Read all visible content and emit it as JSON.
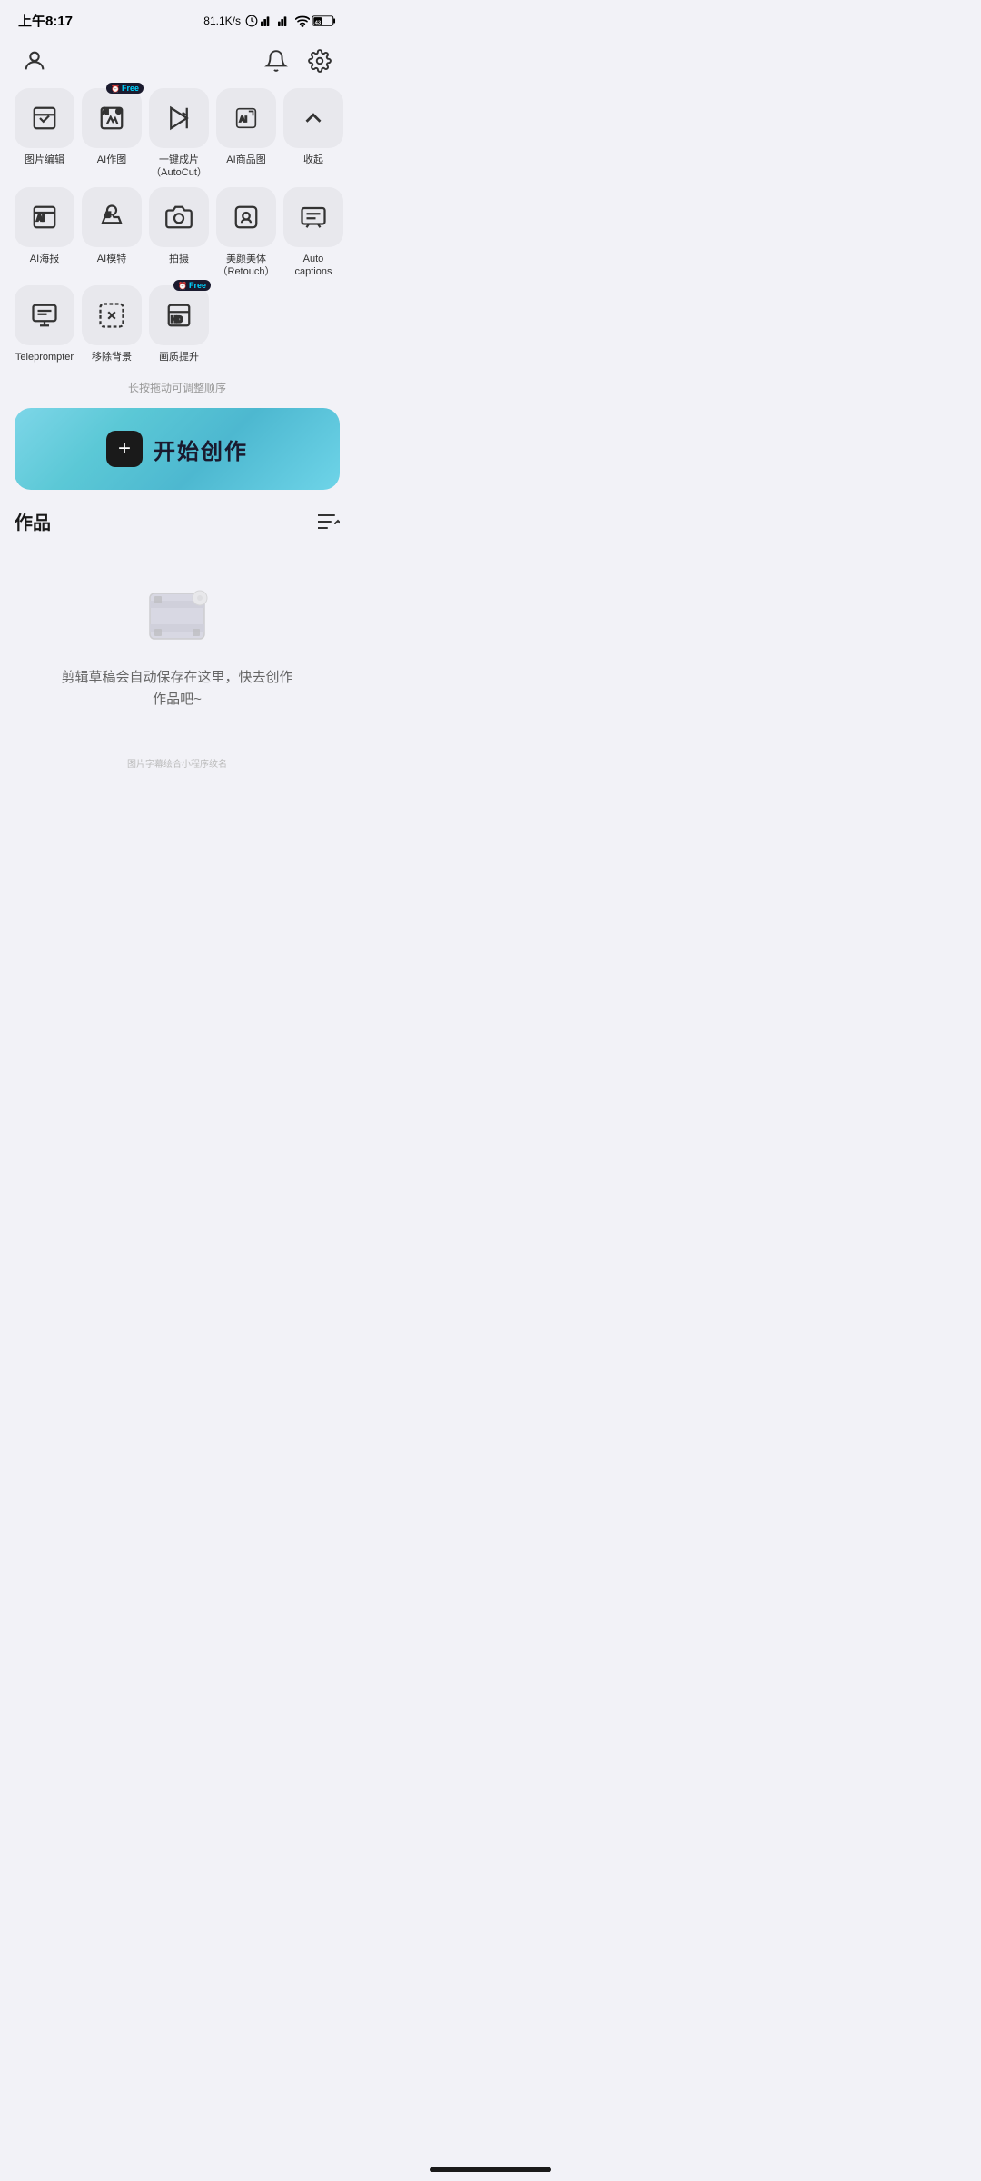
{
  "statusBar": {
    "time": "上午8:17",
    "speed": "81.1K/s",
    "battery": "43"
  },
  "nav": {
    "profileIcon": "person",
    "notificationIcon": "bell",
    "settingsIcon": "gear"
  },
  "toolsRow1": [
    {
      "id": "img-edit",
      "label": "图片编辑",
      "badge": null
    },
    {
      "id": "ai-draw",
      "label": "AI作图",
      "badge": "Free"
    },
    {
      "id": "autocut",
      "label": "一键成片\n（AutoCut）",
      "badge": null
    },
    {
      "id": "ai-product",
      "label": "AI商品图",
      "badge": null
    },
    {
      "id": "collapse",
      "label": "收起",
      "badge": null
    }
  ],
  "toolsRow2": [
    {
      "id": "ai-poster",
      "label": "AI海报",
      "badge": null
    },
    {
      "id": "ai-model",
      "label": "AI模特",
      "badge": null
    },
    {
      "id": "camera",
      "label": "拍摄",
      "badge": null
    },
    {
      "id": "retouch",
      "label": "美颜美体\n（Retouch）",
      "badge": null
    },
    {
      "id": "auto-captions",
      "label": "Auto captions",
      "badge": null
    }
  ],
  "toolsRow3": [
    {
      "id": "teleprompter",
      "label": "Teleprompter",
      "badge": null
    },
    {
      "id": "remove-bg",
      "label": "移除背景",
      "badge": null
    },
    {
      "id": "enhance",
      "label": "画质提升",
      "badge": "Free"
    }
  ],
  "dragHint": "长按拖动可调整顺序",
  "createBtn": {
    "plusLabel": "+",
    "text": "开始创作"
  },
  "works": {
    "title": "作品",
    "emptyLine1": "剪辑草稿会自动保存在这里，快去创作",
    "emptyLine2": "作品吧~"
  },
  "watermark": "图片字幕绘合小程序纹名"
}
